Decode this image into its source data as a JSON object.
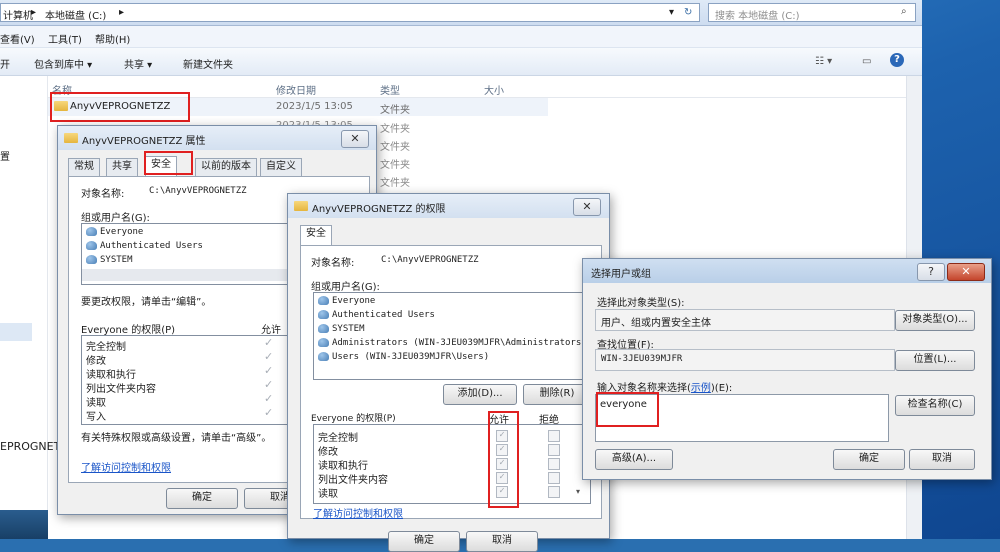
{
  "explorer": {
    "breadcrumb": {
      "computer": "计算机",
      "drive": "本地磁盘 (C:)"
    },
    "search_placeholder": "搜索 本地磁盘 (C:)",
    "menu": [
      "查看(V)",
      "工具(T)",
      "帮助(H)"
    ],
    "toolbar": {
      "open": "开",
      "include": "包含到库中 ▾",
      "share": "共享 ▾",
      "newfolder": "新建文件夹"
    },
    "columns": {
      "name": "名称",
      "date": "修改日期",
      "type": "类型",
      "size": "大小"
    },
    "rows": [
      {
        "name": "AnyvVEPROGNETZZ",
        "date": "2023/1/5 13:05",
        "type": "文件夹"
      },
      {
        "name": "",
        "date": "2023/1/5 13:05",
        "type": "文件夹"
      },
      {
        "name": "",
        "date": "",
        "type": "文件夹"
      },
      {
        "name": "",
        "date": "",
        "type": "文件夹"
      },
      {
        "name": "",
        "date": "",
        "type": "文件夹"
      },
      {
        "name": "",
        "date": "",
        "type": "文件夹"
      },
      {
        "name": "",
        "date": "",
        "type": "文件夹"
      }
    ],
    "nav_text": "置",
    "status_name": "EPROGNET"
  },
  "props": {
    "title": "AnyvVEPROGNETZZ 属性",
    "tabs": [
      "常规",
      "共享",
      "安全",
      "以前的版本",
      "自定义"
    ],
    "object_label": "对象名称:",
    "object_value": "C:\\AnyvVEPROGNETZZ",
    "groups_label": "组或用户名(G):",
    "users": [
      "Everyone",
      "Authenticated Users",
      "SYSTEM"
    ],
    "change_hint": "要更改权限，请单击“编辑”。",
    "perm_label": "Everyone 的权限(P)",
    "allow_label": "允许",
    "perms": [
      "完全控制",
      "修改",
      "读取和执行",
      "列出文件夹内容",
      "读取",
      "写入"
    ],
    "special_hint": "有关特殊权限或高级设置，请单击“高级”。",
    "link": "了解访问控制和权限",
    "ok": "确定",
    "cancel": "取消"
  },
  "perm": {
    "title": "AnyvVEPROGNETZZ 的权限",
    "tab": "安全",
    "object_label": "对象名称:",
    "object_value": "C:\\AnyvVEPROGNETZZ",
    "groups_label": "组或用户名(G):",
    "users": [
      "Everyone",
      "Authenticated Users",
      "SYSTEM",
      "Administrators (WIN-3JEU039MJFR\\Administrators)",
      "Users (WIN-3JEU039MJFR\\Users)"
    ],
    "add": "添加(D)...",
    "remove": "删除(R)",
    "perm_label": "Everyone 的权限(P)",
    "allow_label": "允许",
    "deny_label": "拒绝",
    "perms": [
      "完全控制",
      "修改",
      "读取和执行",
      "列出文件夹内容",
      "读取"
    ],
    "link": "了解访问控制和权限",
    "ok": "确定",
    "cancel": "取消"
  },
  "select": {
    "title": "选择用户或组",
    "type_label": "选择此对象类型(S):",
    "type_value": "用户、组或内置安全主体",
    "type_btn": "对象类型(O)...",
    "loc_label": "查找位置(F):",
    "loc_value": "WIN-3JEU039MJFR",
    "loc_btn": "位置(L)...",
    "name_label_pre": "输入对象名称来选择(",
    "name_label_link": "示例",
    "name_label_post": ")(E):",
    "name_value": "everyone",
    "check_btn": "检查名称(C)",
    "advanced_btn": "高级(A)...",
    "ok": "确定",
    "cancel": "取消"
  }
}
